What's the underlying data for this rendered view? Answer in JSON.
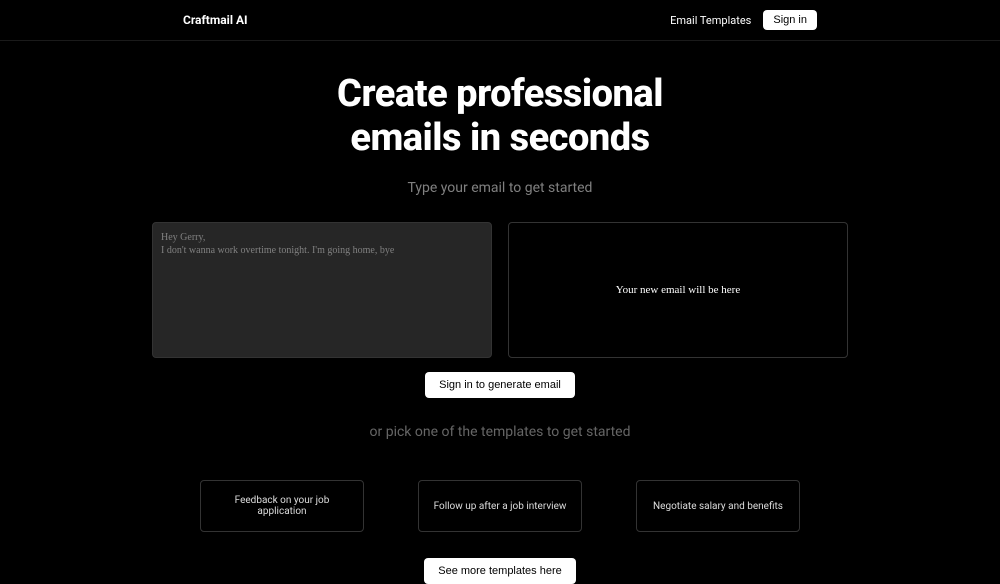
{
  "header": {
    "logo": "Craftmail AI",
    "nav_templates": "Email Templates",
    "signin": "Sign in"
  },
  "hero": {
    "title_line1": "Create professional",
    "title_line2": "emails in seconds",
    "subtitle": "Type your email to get started"
  },
  "input": {
    "line1": "Hey Gerry,",
    "line2": "I don't wanna work overtime tonight. I'm going home, bye"
  },
  "output": {
    "placeholder": "Your new email will be here"
  },
  "cta": {
    "generate": "Sign in to generate email",
    "templates_label": "or pick one of the templates to get started",
    "see_more": "See more templates here"
  },
  "templates": [
    "Feedback on your job application",
    "Follow up after a job interview",
    "Negotiate salary and benefits"
  ]
}
